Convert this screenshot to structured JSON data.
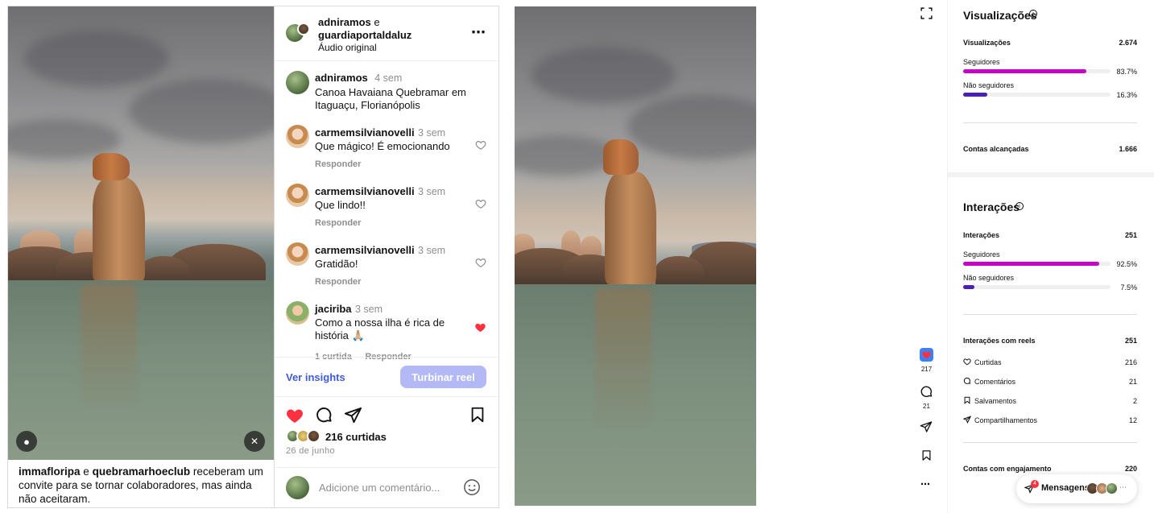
{
  "post": {
    "header": {
      "user1": "adniramos",
      "conj": "e",
      "user2": "guardiaportaldaluz",
      "audio": "Áudio original",
      "more_icon": "more-horizontal-icon"
    },
    "caption": {
      "user": "adniramos",
      "time": "4 sem",
      "text": "Canoa Havaiana Quebramar em Itaguaçu, Florianópolis"
    },
    "comments": [
      {
        "user": "carmemsilvianovelli",
        "time": "3 sem",
        "text": "Que mágico! É emocionando",
        "reply": "Responder",
        "liked": false
      },
      {
        "user": "carmemsilvianovelli",
        "time": "3 sem",
        "text": "Que lindo!!",
        "reply": "Responder",
        "liked": false
      },
      {
        "user": "carmemsilvianovelli",
        "time": "3 sem",
        "text": "Gratidão!",
        "reply": "Responder",
        "liked": false
      },
      {
        "user": "jaciriba",
        "time": "3 sem",
        "text": "Como a nossa ilha é rica de história 🙏🏼",
        "likes": "1 curtida",
        "reply": "Responder",
        "liked": true
      }
    ],
    "insights_link": "Ver insights",
    "boost_button": "Turbinar reel",
    "likes": "216 curtidas",
    "date": "26 de junho",
    "comment_placeholder": "Adicione um comentário...",
    "collab_notice": {
      "user1": "immafloripa",
      "conj": "e",
      "user2": "quebramarhoeclub",
      "rest": "receberam um convite para se tornar colaboradores, mas ainda não aceitaram."
    },
    "colors": {
      "like_red": "#ff3040",
      "link_blue": "#3f5bd6",
      "boost_bg": "#b3b9f5"
    }
  },
  "reel_actions": {
    "like_count": "217",
    "comment_count": "21"
  },
  "insights": {
    "views": {
      "title": "Visualizações",
      "label": "Visualizações",
      "value": "2.674",
      "followers_label": "Seguidores",
      "followers_pct": "83.7%",
      "followers_fraction": 0.837,
      "nonfollowers_label": "Não seguidores",
      "nonfollowers_pct": "16.3%",
      "nonfollowers_fraction": 0.163,
      "reach_label": "Contas alcançadas",
      "reach_value": "1.666"
    },
    "interactions": {
      "title": "Interações",
      "label": "Interações",
      "value": "251",
      "followers_label": "Seguidores",
      "followers_pct": "92.5%",
      "followers_fraction": 0.925,
      "nonfollowers_label": "Não seguidores",
      "nonfollowers_pct": "7.5%",
      "nonfollowers_fraction": 0.075,
      "reel_label": "Interações com reels",
      "reel_value": "251",
      "rows": [
        {
          "icon": "heart-icon",
          "label": "Curtidas",
          "value": "216"
        },
        {
          "icon": "comment-icon",
          "label": "Comentários",
          "value": "21"
        },
        {
          "icon": "bookmark-icon",
          "label": "Salvamentos",
          "value": "2"
        },
        {
          "icon": "share-icon",
          "label": "Compartilhamentos",
          "value": "12"
        }
      ],
      "engaged_label": "Contas com engajamento",
      "engaged_value": "220"
    },
    "colors": {
      "followers": "#c800c8",
      "nonfollowers": "#4b1fb5"
    }
  },
  "messages": {
    "label": "Mensagens",
    "badge": "4"
  }
}
